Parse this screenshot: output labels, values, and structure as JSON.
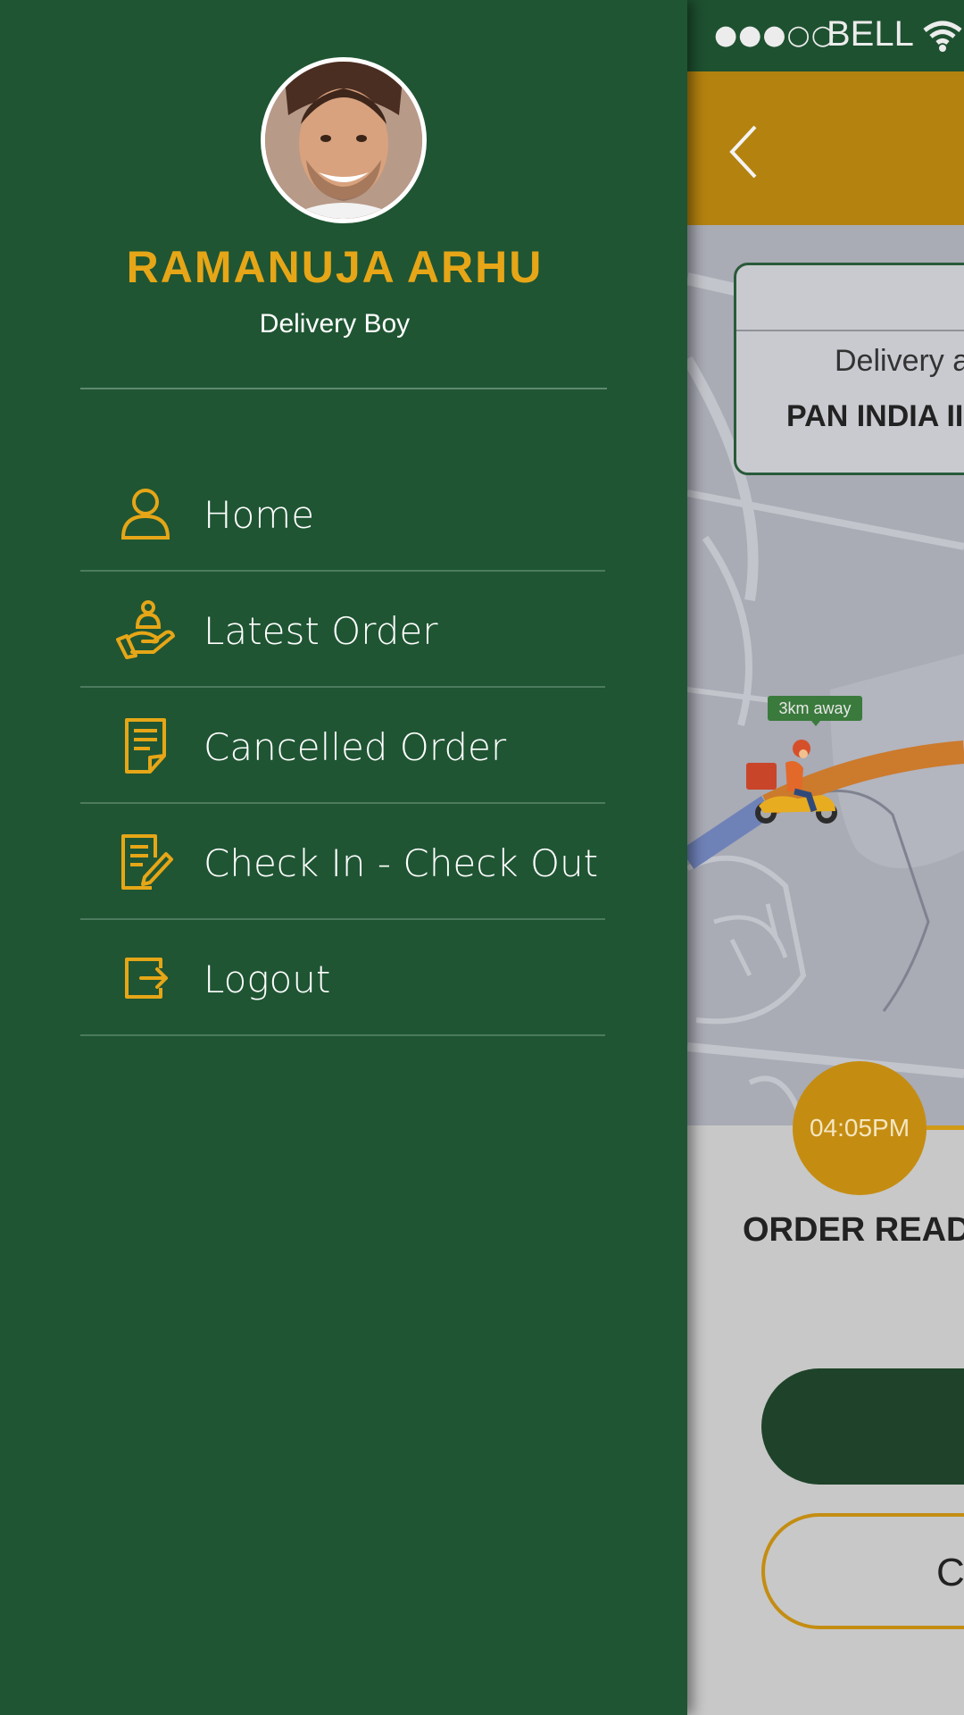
{
  "status_bar": {
    "signal": "●●●○○",
    "carrier": "BELL"
  },
  "map": {
    "card": {
      "delivery_label": "Delivery a",
      "delivery_address": "PAN INDIA II"
    },
    "distance_badge": "3km away",
    "route_colors": {
      "traveled": "#6f82b8",
      "remaining": "#cc7a2c"
    }
  },
  "order": {
    "time": "04:05PM",
    "status": "ORDER READY",
    "secondary_button_label": "C"
  },
  "drawer": {
    "user": {
      "name": "RAMANUJA ARHU",
      "role": "Delivery Boy"
    },
    "menu": [
      {
        "label": "Home",
        "icon": "user-icon"
      },
      {
        "label": "Latest Order",
        "icon": "hand-delivery-icon"
      },
      {
        "label": "Cancelled Order",
        "icon": "document-icon"
      },
      {
        "label": "Check In - Check Out",
        "icon": "edit-document-icon"
      },
      {
        "label": "Logout",
        "icon": "logout-icon"
      }
    ]
  },
  "colors": {
    "drawer_bg": "#1f5533",
    "accent": "#e6a617",
    "app_bar": "#b4820f",
    "status_bar": "#1e5130",
    "primary_button": "#1f432a"
  }
}
